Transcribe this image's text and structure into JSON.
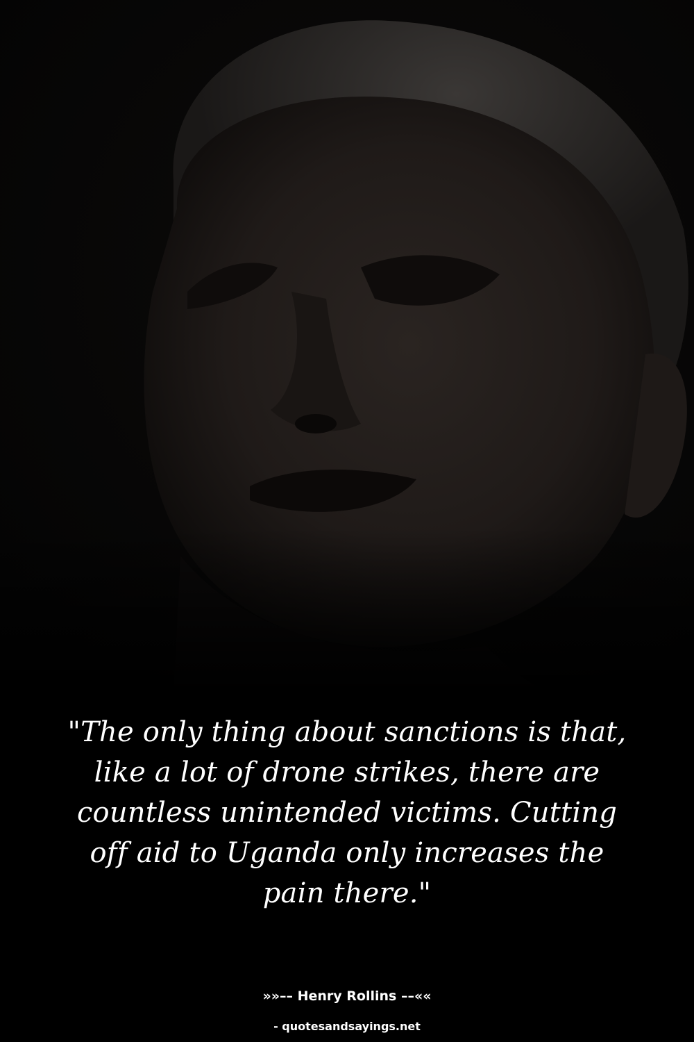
{
  "quote": {
    "lines": [
      "\"The only thing about sanctions is that,",
      "like a lot of drone strikes, there are",
      "countless unintended victims. Cutting",
      "off aid to Uganda only increases the",
      "pain there.\""
    ]
  },
  "author": {
    "text": "»»–– Henry Rollins ––««"
  },
  "source": {
    "text": "- quotesandsayings.net"
  },
  "colors": {
    "background": "#070707",
    "text": "#ffffff"
  }
}
